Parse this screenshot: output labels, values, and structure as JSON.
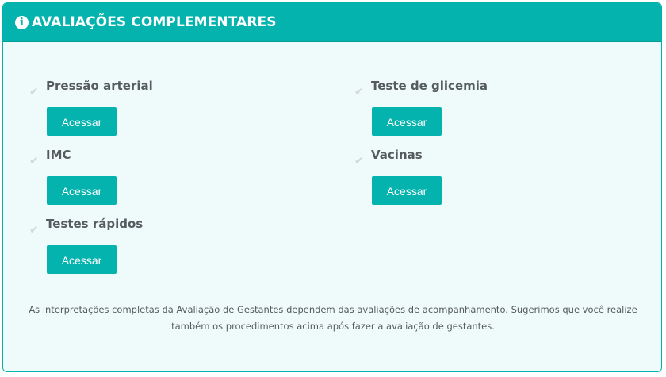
{
  "header": {
    "icon": "info-icon",
    "icon_glyph": "i",
    "title": "AVALIAÇÕES COMPLEMENTARES",
    "color": "#05b3ae"
  },
  "items": [
    {
      "title": "Pressão arterial",
      "button_label": "Acessar"
    },
    {
      "title": "Teste de glicemia",
      "button_label": "Acessar"
    },
    {
      "title": "IMC",
      "button_label": "Acessar"
    },
    {
      "title": "Vacinas",
      "button_label": "Acessar"
    },
    {
      "title": "Testes rápidos",
      "button_label": "Acessar"
    }
  ],
  "check_icon": "checkmark-icon",
  "note": {
    "line1": "As interpretações completas da Avaliação de Gestantes dependem das avaliações de acompanhamento. Sugerimos que você realize",
    "line2": "também os procedimentos acima após fazer a avaliação de gestantes."
  }
}
